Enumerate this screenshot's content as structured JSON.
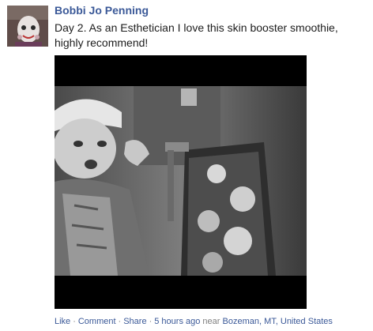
{
  "post": {
    "author_name": "Bobbi Jo Penning",
    "message": "Day 2. As an Esthetician I love this skin booster smoothie, highly recommend!",
    "photo_alt": "Black and white selfie photo",
    "actions": {
      "like_label": "Like",
      "comment_label": "Comment",
      "share_label": "Share",
      "separator": "·",
      "timestamp": "5 hours ago",
      "location_prefix": "near",
      "location": "Bozeman, MT, United States"
    }
  },
  "colors": {
    "link": "#3b5998",
    "meta_text": "#808080",
    "body_text": "#1c1c1c"
  }
}
